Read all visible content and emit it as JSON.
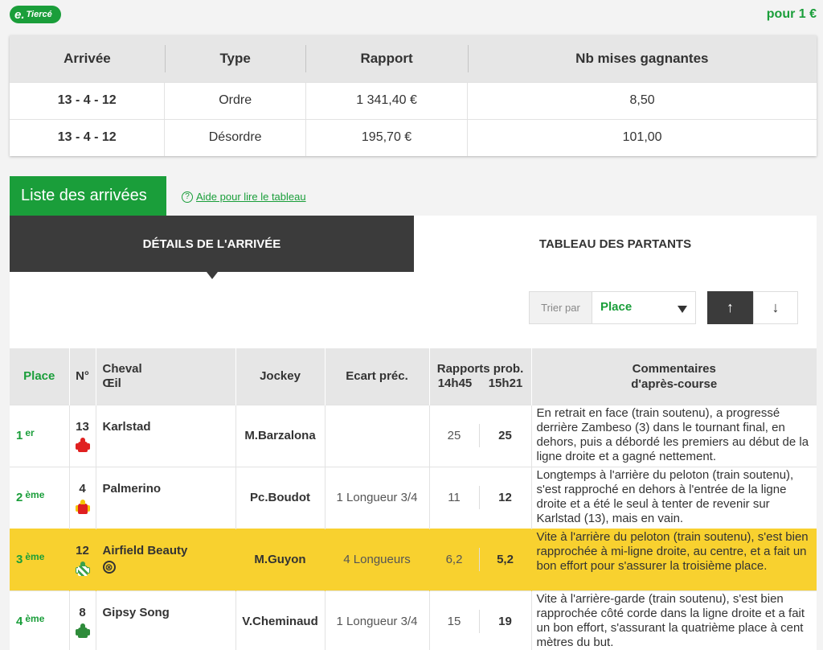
{
  "brand": {
    "logo_e": "e.",
    "logo_text": "Tiercé"
  },
  "pour": "pour 1 €",
  "rapports": {
    "headers": [
      "Arrivée",
      "Type",
      "Rapport",
      "Nb mises gagnantes"
    ],
    "rows": [
      {
        "arrivee": "13 - 4 - 12",
        "type": "Ordre",
        "rapport": "1 341,40 €",
        "nb": "8,50"
      },
      {
        "arrivee": "13 - 4 - 12",
        "type": "Désordre",
        "rapport": "195,70 €",
        "nb": "101,00"
      }
    ]
  },
  "section": {
    "title": "Liste des arrivées",
    "help_icon": "?",
    "help_link": "Aide pour lire le tableau"
  },
  "tabs": {
    "active": "DÉTAILS DE L'ARRIVÉE",
    "inactive": "TABLEAU DES PARTANTS"
  },
  "sort": {
    "label": "Trier par",
    "value": "Place",
    "up": "↑",
    "down": "↓"
  },
  "table": {
    "headers": {
      "place": "Place",
      "num": "N°",
      "cheval_1": "Cheval",
      "cheval_2": "Œil",
      "jockey": "Jockey",
      "ecart": "Ecart préc.",
      "rapports": "Rapports prob.",
      "t1": "14h45",
      "t2": "15h21",
      "comm_1": "Commentaires",
      "comm_2": "d'après-course"
    },
    "rows": [
      {
        "place": "1",
        "sup": "er",
        "num": "13",
        "cheval": "Karlstad",
        "oeil": "",
        "jockey": "M.Barzalona",
        "ecart": "",
        "r1": "25",
        "r2": "25",
        "comment": "En retrait en face (train soutenu), a progressé derrière Zambeso (3) dans le tournant final, en dehors, puis a débordé les premiers au début de la ligne droite et a gagné nettement.",
        "silk": {
          "body": "#e02020",
          "arms": "#e02020",
          "cap": "#e02020"
        }
      },
      {
        "place": "2",
        "sup": "ème",
        "num": "4",
        "cheval": "Palmerino",
        "oeil": "",
        "jockey": "Pc.Boudot",
        "ecart": "1 Longueur 3/4",
        "r1": "11",
        "r2": "12",
        "comment": "Longtemps à l'arrière du peloton (train soutenu), s'est rapproché en dehors à l'entrée de la ligne droite et a été le seul à tenter de revenir sur Karlstad (13), mais en vain.",
        "silk": {
          "body": "#e02020",
          "arms": "#f5c400",
          "cap": "#f5c400"
        }
      },
      {
        "place": "3",
        "sup": "ème",
        "num": "12",
        "cheval": "Airfield Beauty",
        "oeil": "⊗",
        "jockey": "M.Guyon",
        "ecart": "4 Longueurs",
        "r1": "6,2",
        "r2": "5,2",
        "comment": "Vite à l'arrière du peloton (train soutenu), s'est bien rapprochée à mi-ligne droite, au centre, et a fait un bon effort pour s'assurer la troisième place.",
        "silk": {
          "body": "#3aa14a",
          "arms": "#ffffff",
          "cap": "#3aa14a"
        }
      },
      {
        "place": "4",
        "sup": "ème",
        "num": "8",
        "cheval": "Gipsy Song",
        "oeil": "",
        "jockey": "V.Cheminaud",
        "ecart": "1 Longueur 3/4",
        "r1": "15",
        "r2": "19",
        "comment": "Vite à l'arrière-garde (train soutenu), s'est bien rapprochée côté corde dans la ligne droite et a fait un bon effort, s'assurant la quatrième place à cent mètres du but.",
        "silk": {
          "body": "#2e8b3a",
          "arms": "#2e8b3a",
          "cap": "#2e8b3a"
        }
      }
    ]
  }
}
